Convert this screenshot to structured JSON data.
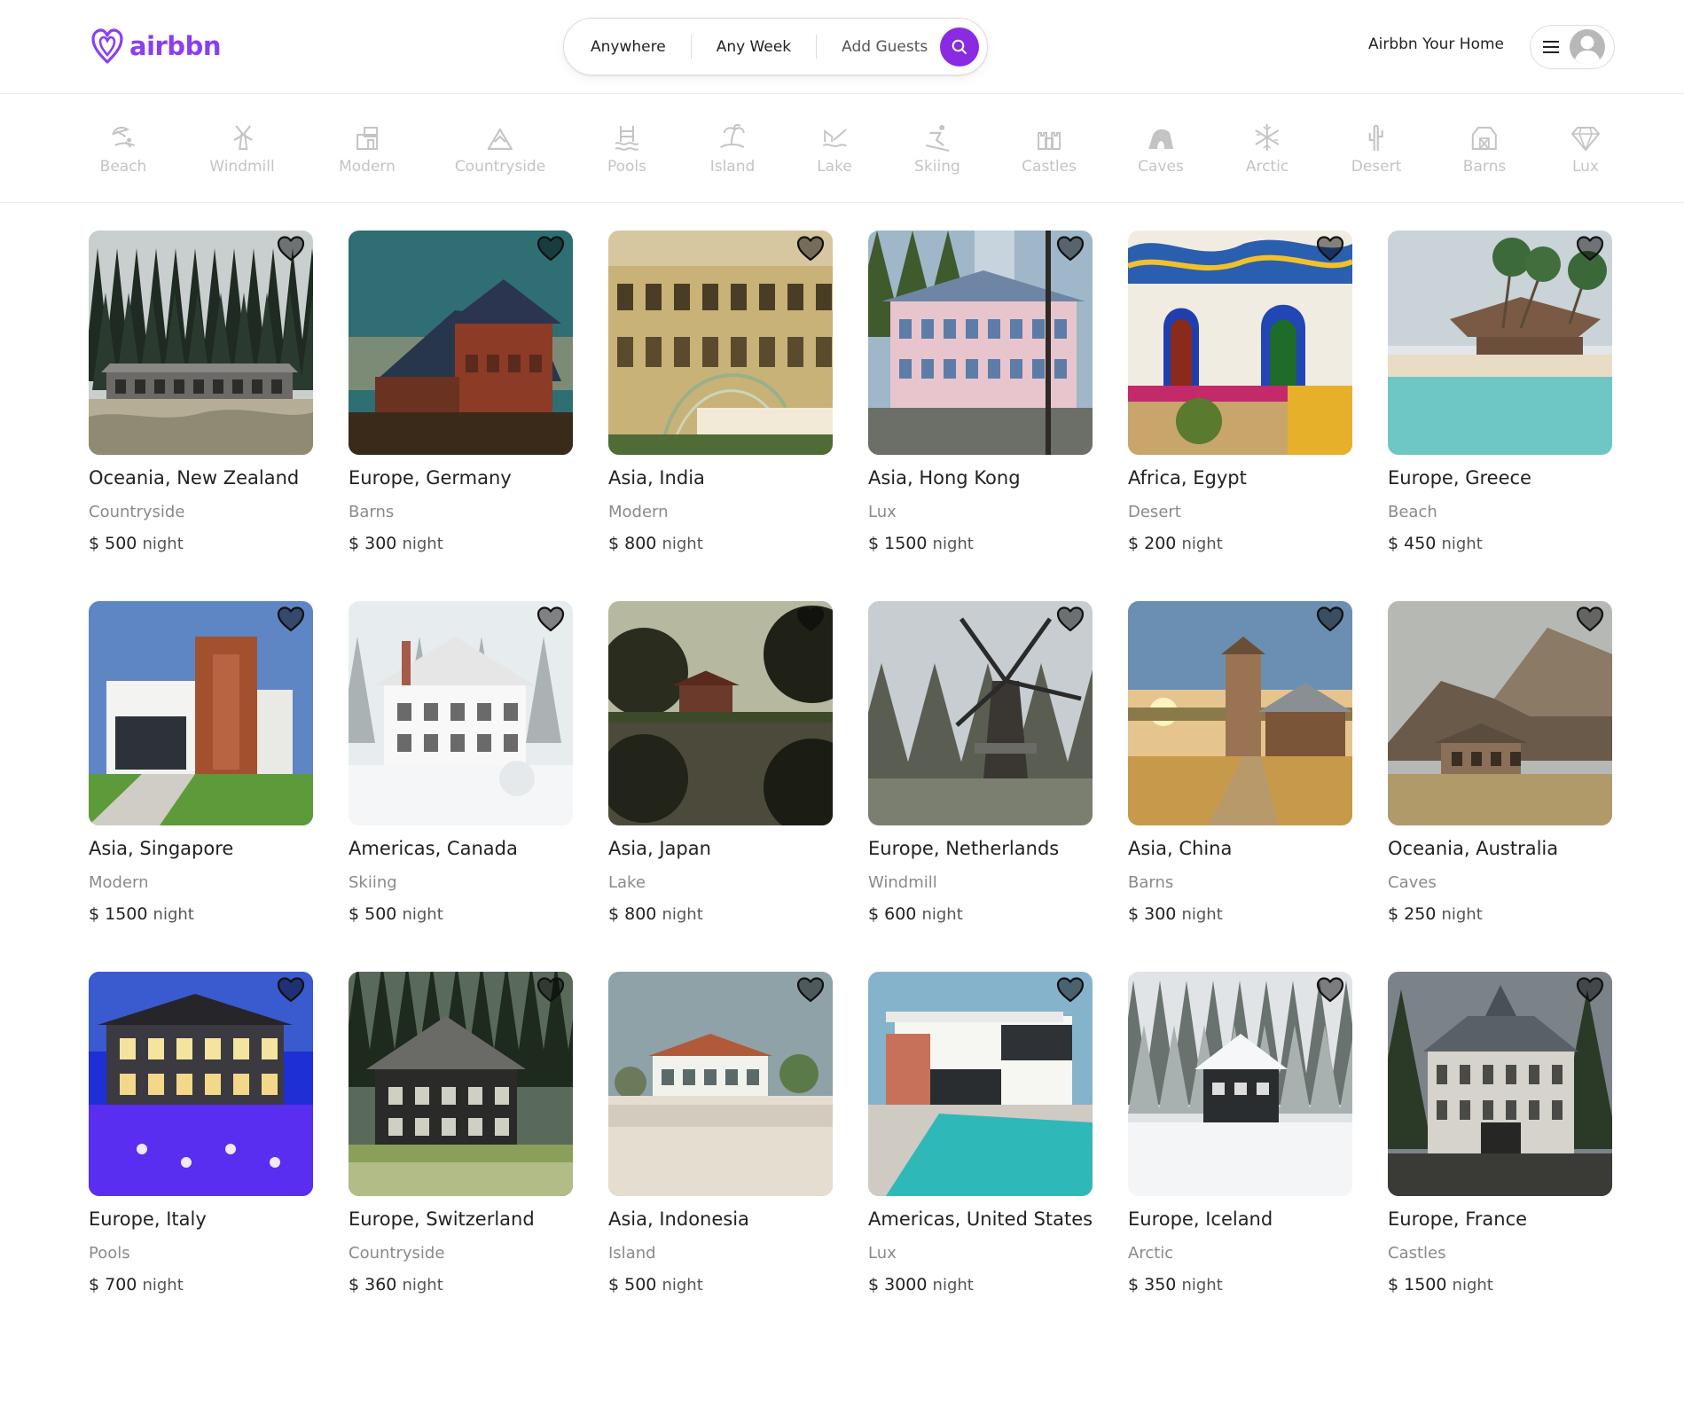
{
  "header": {
    "logo_text": "airbbn",
    "search": {
      "where": "Anywhere",
      "when": "Any Week",
      "who": "Add Guests"
    },
    "host_link": "Airbbn Your Home"
  },
  "categories": [
    {
      "label": "Beach",
      "icon": "beach-icon"
    },
    {
      "label": "Windmill",
      "icon": "windmill-icon"
    },
    {
      "label": "Modern",
      "icon": "modern-icon"
    },
    {
      "label": "Countryside",
      "icon": "countryside-icon"
    },
    {
      "label": "Pools",
      "icon": "pool-icon"
    },
    {
      "label": "Island",
      "icon": "island-icon"
    },
    {
      "label": "Lake",
      "icon": "lake-icon"
    },
    {
      "label": "Skiing",
      "icon": "skiing-icon"
    },
    {
      "label": "Castles",
      "icon": "castle-icon"
    },
    {
      "label": "Caves",
      "icon": "cave-icon"
    },
    {
      "label": "Arctic",
      "icon": "snowflake-icon"
    },
    {
      "label": "Desert",
      "icon": "cactus-icon"
    },
    {
      "label": "Barns",
      "icon": "barn-icon"
    },
    {
      "label": "Lux",
      "icon": "diamond-icon"
    }
  ],
  "listings": [
    {
      "location": "Oceania, New Zealand",
      "category": "Countryside",
      "price": "$ 500",
      "unit": "night",
      "scene": "forest-house"
    },
    {
      "location": "Europe, Germany",
      "category": "Barns",
      "price": "$ 300",
      "unit": "night",
      "scene": "red-barn"
    },
    {
      "location": "Asia, India",
      "category": "Modern",
      "price": "$ 800",
      "unit": "night",
      "scene": "palace"
    },
    {
      "location": "Asia, Hong Kong",
      "category": "Lux",
      "price": "$ 1500",
      "unit": "night",
      "scene": "pink-mansion"
    },
    {
      "location": "Africa, Egypt",
      "category": "Desert",
      "price": "$ 200",
      "unit": "night",
      "scene": "painted-house"
    },
    {
      "location": "Europe, Greece",
      "category": "Beach",
      "price": "$ 450",
      "unit": "night",
      "scene": "beach-hut"
    },
    {
      "location": "Asia, Singapore",
      "category": "Modern",
      "price": "$ 1500",
      "unit": "night",
      "scene": "modern-house"
    },
    {
      "location": "Americas, Canada",
      "category": "Skiing",
      "price": "$ 500",
      "unit": "night",
      "scene": "snow-house"
    },
    {
      "location": "Asia, Japan",
      "category": "Lake",
      "price": "$ 800",
      "unit": "night",
      "scene": "lake-house"
    },
    {
      "location": "Europe, Netherlands",
      "category": "Windmill",
      "price": "$ 600",
      "unit": "night",
      "scene": "windmill"
    },
    {
      "location": "Asia, China",
      "category": "Barns",
      "price": "$ 300",
      "unit": "night",
      "scene": "sunset-barn"
    },
    {
      "location": "Oceania, Australia",
      "category": "Caves",
      "price": "$ 250",
      "unit": "night",
      "scene": "mountain-house"
    },
    {
      "location": "Europe, Italy",
      "category": "Pools",
      "price": "$ 700",
      "unit": "night",
      "scene": "night-pool"
    },
    {
      "location": "Europe, Switzerland",
      "category": "Countryside",
      "price": "$ 360",
      "unit": "night",
      "scene": "dark-chalet"
    },
    {
      "location": "Asia, Indonesia",
      "category": "Island",
      "price": "$ 500",
      "unit": "night",
      "scene": "dune-house"
    },
    {
      "location": "Americas, United States",
      "category": "Lux",
      "price": "$ 3000",
      "unit": "night",
      "scene": "villa-pool"
    },
    {
      "location": "Europe, Iceland",
      "category": "Arctic",
      "price": "$ 350",
      "unit": "night",
      "scene": "snow-cabin"
    },
    {
      "location": "Europe, France",
      "category": "Castles",
      "price": "$ 1500",
      "unit": "night",
      "scene": "chateau"
    }
  ],
  "colors": {
    "brand": "#8a2be2",
    "muted_icon": "#c4c4c4"
  }
}
